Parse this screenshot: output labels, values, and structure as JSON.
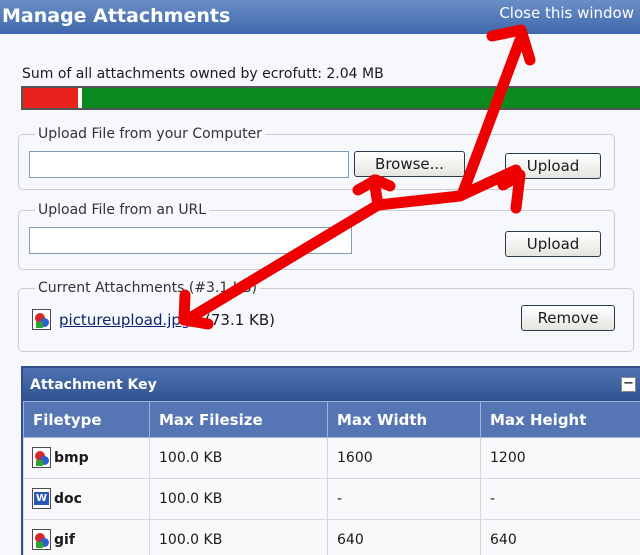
{
  "header": {
    "title": "Manage Attachments",
    "close_label": "Close this window"
  },
  "quota": {
    "text": "Sum of all attachments owned by ecrofutt: 2.04 MB",
    "used_fraction": 0.095
  },
  "upload_computer": {
    "legend": "Upload File from your Computer",
    "input_value": "",
    "browse_label": "Browse...",
    "upload_label": "Upload"
  },
  "upload_url": {
    "legend": "Upload File from an URL",
    "input_value": "",
    "upload_label": "Upload"
  },
  "current": {
    "legend": "Current Attachments (#3.1 KB)",
    "filename": "pictureupload.jpg",
    "filesize": "(73.1 KB)",
    "remove_label": "Remove"
  },
  "key": {
    "title": "Attachment Key",
    "collapse_label": "−",
    "headers": [
      "Filetype",
      "Max Filesize",
      "Max Width",
      "Max Height"
    ],
    "rows": [
      {
        "type": "bmp",
        "icon": "image-file-icon",
        "filesize": "100.0 KB",
        "width": "1600",
        "height": "1200"
      },
      {
        "type": "doc",
        "icon": "word-document-icon",
        "filesize": "100.0 KB",
        "width": "-",
        "height": "-"
      },
      {
        "type": "gif",
        "icon": "image-file-icon",
        "filesize": "100.0 KB",
        "width": "640",
        "height": "640"
      }
    ]
  },
  "annotation_color": "#ee0000"
}
